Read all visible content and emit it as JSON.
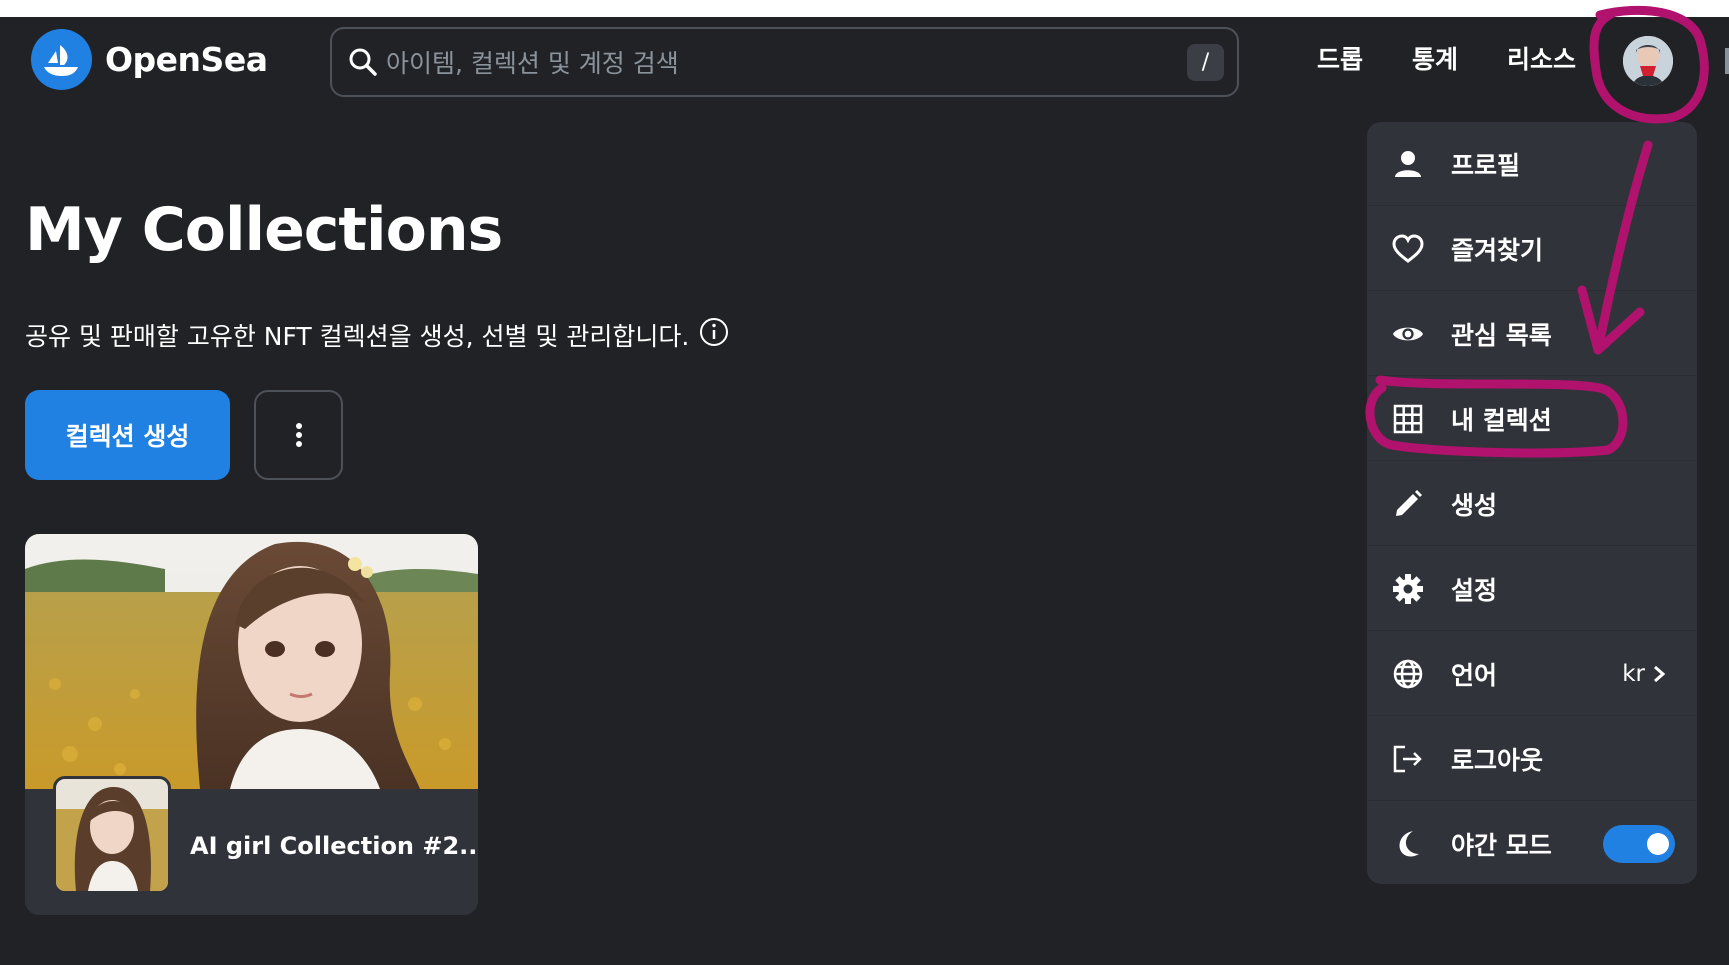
{
  "header": {
    "brand": "OpenSea",
    "search_placeholder": "아이템, 컬렉션 및 계정 검색",
    "search_shortcut": "/",
    "nav": [
      "드롭",
      "통계",
      "리소스"
    ]
  },
  "main": {
    "title": "My Collections",
    "subtitle": "공유 및 판매할 고유한 NFT 컬렉션을 생성, 선별 및 관리합니다.",
    "create_button": "컬렉션 생성",
    "collections": [
      {
        "name": "AI girl Collection #2..."
      }
    ]
  },
  "menu": {
    "items": [
      {
        "label": "프로필",
        "icon": "person-icon"
      },
      {
        "label": "즐겨찾기",
        "icon": "heart-icon"
      },
      {
        "label": "관심 목록",
        "icon": "eye-icon"
      },
      {
        "label": "내 컬렉션",
        "icon": "grid-icon"
      },
      {
        "label": "생성",
        "icon": "pencil-icon"
      },
      {
        "label": "설정",
        "icon": "gear-icon"
      },
      {
        "label": "언어",
        "icon": "globe-icon",
        "value": "kr"
      },
      {
        "label": "로그아웃",
        "icon": "logout-icon"
      },
      {
        "label": "야간 모드",
        "icon": "moon-icon",
        "toggle_on": true
      }
    ]
  },
  "colors": {
    "background": "#202225",
    "panel": "#303339",
    "accent": "#2081e2",
    "annotation": "#b0126e"
  }
}
